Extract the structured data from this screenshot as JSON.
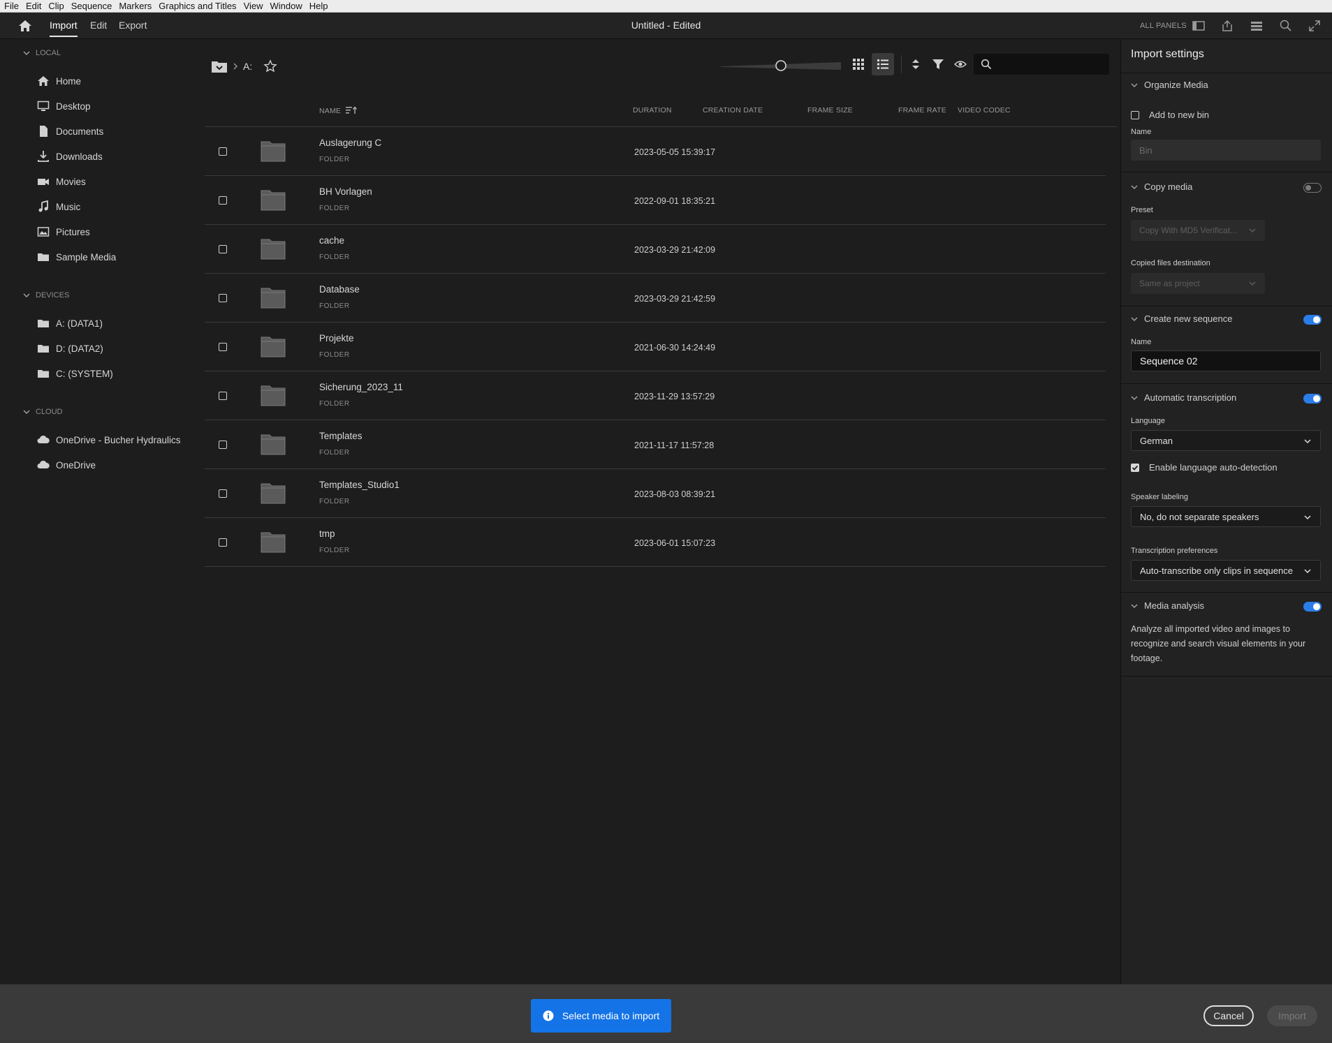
{
  "menubar": [
    "File",
    "Edit",
    "Clip",
    "Sequence",
    "Markers",
    "Graphics and Titles",
    "View",
    "Window",
    "Help"
  ],
  "header": {
    "tabs": [
      "Import",
      "Edit",
      "Export"
    ],
    "title": "Untitled - Edited",
    "all_panels": "ALL PANELS"
  },
  "sidebar": {
    "local_label": "LOCAL",
    "local_items": [
      "Home",
      "Desktop",
      "Documents",
      "Downloads",
      "Movies",
      "Music",
      "Pictures",
      "Sample Media"
    ],
    "devices_label": "DEVICES",
    "device_items": [
      "A: (DATA1)",
      "D: (DATA2)",
      "C: (SYSTEM)"
    ],
    "cloud_label": "CLOUD",
    "cloud_items": [
      "OneDrive - Bucher Hydraulics",
      "OneDrive"
    ]
  },
  "browser": {
    "breadcrumb": "A:",
    "zoom_fraction": 0.5,
    "columns": {
      "name": "NAME",
      "duration": "DURATION",
      "creation_date": "CREATION DATE",
      "frame_size": "FRAME SIZE",
      "frame_rate": "FRAME RATE",
      "video_codec": "VIDEO CODEC"
    },
    "rows": [
      {
        "name": "Auslagerung C",
        "kind": "FOLDER",
        "date": "2023-05-05 15:39:17"
      },
      {
        "name": "BH Vorlagen",
        "kind": "FOLDER",
        "date": "2022-09-01 18:35:21"
      },
      {
        "name": "cache",
        "kind": "FOLDER",
        "date": "2023-03-29 21:42:09"
      },
      {
        "name": "Database",
        "kind": "FOLDER",
        "date": "2023-03-29 21:42:59"
      },
      {
        "name": "Projekte",
        "kind": "FOLDER",
        "date": "2021-06-30 14:24:49"
      },
      {
        "name": "Sicherung_2023_11",
        "kind": "FOLDER",
        "date": "2023-11-29 13:57:29"
      },
      {
        "name": "Templates",
        "kind": "FOLDER",
        "date": "2021-11-17 11:57:28"
      },
      {
        "name": "Templates_Studio1",
        "kind": "FOLDER",
        "date": "2023-08-03 08:39:21"
      },
      {
        "name": "tmp",
        "kind": "FOLDER",
        "date": "2023-06-01 15:07:23"
      }
    ]
  },
  "settings": {
    "title": "Import settings",
    "organize": {
      "label": "Organize Media",
      "add_to_bin": "Add to new bin",
      "name_label": "Name",
      "name_placeholder": "Bin"
    },
    "copy": {
      "label": "Copy media",
      "preset_label": "Preset",
      "preset_value": "Copy With MD5 Verificat...",
      "dest_label": "Copied files destination",
      "dest_value": "Same as project"
    },
    "sequence": {
      "label": "Create new sequence",
      "name_label": "Name",
      "name_value": "Sequence 02"
    },
    "transcription": {
      "label": "Automatic transcription",
      "language_label": "Language",
      "language_value": "German",
      "auto_detect": "Enable language auto-detection",
      "speaker_label": "Speaker labeling",
      "speaker_value": "No, do not separate speakers",
      "prefs_label": "Transcription preferences",
      "prefs_value": "Auto-transcribe only clips in sequence"
    },
    "analysis": {
      "label": "Media analysis",
      "description": "Analyze all imported video and images to recognize and search visual elements in your footage."
    }
  },
  "footer": {
    "toast": "Select media to import",
    "cancel": "Cancel",
    "import": "Import"
  },
  "colors": {
    "accent": "#1473e6",
    "toggle_on": "#2b7de9"
  }
}
